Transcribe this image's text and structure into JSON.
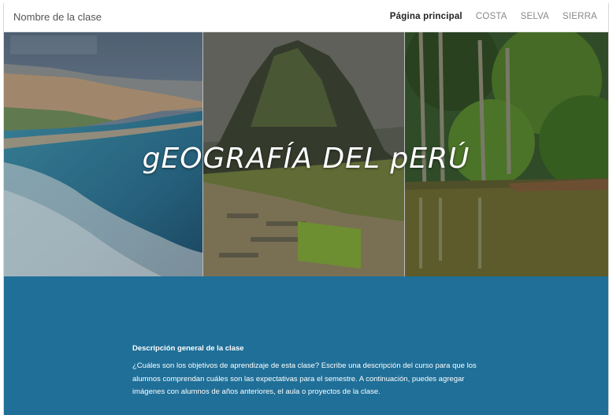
{
  "header": {
    "site_title": "Nombre de la clase",
    "nav": [
      {
        "label": "Página principal",
        "active": true
      },
      {
        "label": "COSTA",
        "active": false
      },
      {
        "label": "SELVA",
        "active": false
      },
      {
        "label": "SIERRA",
        "active": false
      }
    ]
  },
  "hero": {
    "title": "gEOGRAFÍA DEL pERÚ"
  },
  "description": {
    "title": "Descripción general de la clase",
    "body": "¿Cuáles son los objetivos de aprendizaje de esta clase? Escribe una descripción del curso para que los alumnos comprendan cuáles son las expectativas para el semestre. A continuación, puedes agregar imágenes con alumnos de años anteriores, el aula o proyectos de la clase."
  },
  "colors": {
    "section_bg": "#1f6f98",
    "header_bg": "#ffffff",
    "text_light": "#ffffff"
  }
}
